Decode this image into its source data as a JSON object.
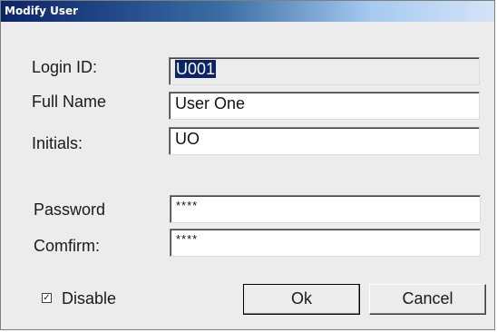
{
  "dialog": {
    "title": "Modify User"
  },
  "fields": {
    "login_id": {
      "label": "Login ID:",
      "value": "U001"
    },
    "full_name": {
      "label": "Full Name",
      "value": "User One"
    },
    "initials": {
      "label": "Initials:",
      "value": "UO"
    },
    "password": {
      "label": "Password",
      "value": "****"
    },
    "confirm": {
      "label": "Comfirm:",
      "value": "****"
    }
  },
  "disable": {
    "label": "Disable",
    "checked": true,
    "mark": "✓"
  },
  "buttons": {
    "ok": "Ok",
    "cancel": "Cancel"
  }
}
